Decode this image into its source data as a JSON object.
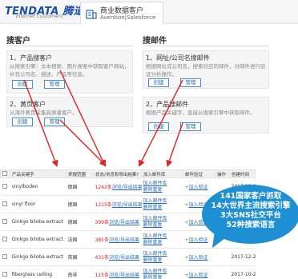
{
  "header": {
    "logo_main": "TENDATA 腾道",
    "logo_sub": "Internet Customers",
    "tab_title": "商业数据客户",
    "tab_subtitle": "Avention|Salesforce"
  },
  "search_customers": {
    "title": "搜客户",
    "card1": {
      "title": "1、产品搜客户",
      "desc": "从搜索引擎：文本搜索、图片搜索中获取客户网站，补充公司名、描述、产品等信息。",
      "create": "创建",
      "manage": "管理"
    },
    "card2": {
      "title": "2、黄页客户",
      "desc": "从海外黄页采集高质量客户。",
      "create": "创建",
      "manage": "管理"
    }
  },
  "search_emails": {
    "title": "搜邮件",
    "card1": {
      "title": "1、网址/公司名搜邮件",
      "desc": "根据网址或公司名，搜索对应的邮件，对邮件进行验证分析操作。",
      "create": "创建",
      "manage": "管理"
    },
    "card2": {
      "title": "2、产品搜邮件",
      "desc": "根据产品关键字，直接从搜索引擎中获取邮件。",
      "create": "创建",
      "manage": "管理"
    }
  },
  "table": {
    "headers": [
      "",
      "产品关键字",
      "来搜范围",
      "状态/浏览和导出结果?",
      "加入邮件库",
      "邮件验证",
      "操作",
      "创建时间"
    ],
    "rows": [
      {
        "keyword": "vinylboden",
        "region": "德国",
        "count": "1242条",
        "view": "浏览/导出结果",
        "add": "加入邮件库",
        "remove": "删除重复",
        "verify": "加入验证",
        "op": "",
        "date": "2017-12-29"
      },
      {
        "keyword": "vinyl floor",
        "region": "德国",
        "count": "1215条",
        "view": "浏览/导出结果",
        "add": "加入邮件库",
        "remove": "删除重复",
        "verify": "加入验证",
        "op": "",
        "date": "2017-12-29"
      },
      {
        "keyword": "Ginkgo biloba extract",
        "region": "德国",
        "count": "399条",
        "view": "浏览/导出结果",
        "add": "加入邮件库",
        "remove": "删除重复",
        "verify": "加入验证",
        "op": "",
        "date": "2017-12-29"
      },
      {
        "keyword": "Ginkgo biloba extract",
        "region": "法国",
        "count": "385条",
        "view": "浏览/导出结果",
        "add": "加入邮件库",
        "remove": "删除重复",
        "verify": "加入验证",
        "op": "",
        "date": "2017-12-29"
      },
      {
        "keyword": "Ginkgo biloba extract",
        "region": "英国",
        "count": "431条",
        "view": "浏览/导出结果",
        "add": "加入邮件库",
        "remove": "删除重复",
        "verify": "加入验证",
        "op": "",
        "date": "2017-12-29"
      },
      {
        "keyword": "fiberglass ceiling",
        "region": "南非",
        "count": "115条",
        "view": "浏览/导出结果",
        "add": "加入邮件库",
        "remove": "删除重复",
        "verify": "加入验证",
        "op": "",
        "date": "2017-10-24"
      }
    ]
  },
  "bubble": {
    "line1": "141国家客户抓取",
    "line2": "14大世界主流搜索引擎",
    "line3": "3大SNS社交平台",
    "line4": "52种搜索语言"
  },
  "colors": {
    "accent_blue": "#2b6cb0",
    "bubble_blue": "#1d8fd2",
    "arrow_red": "#e02424",
    "count_red": "#d52020"
  }
}
